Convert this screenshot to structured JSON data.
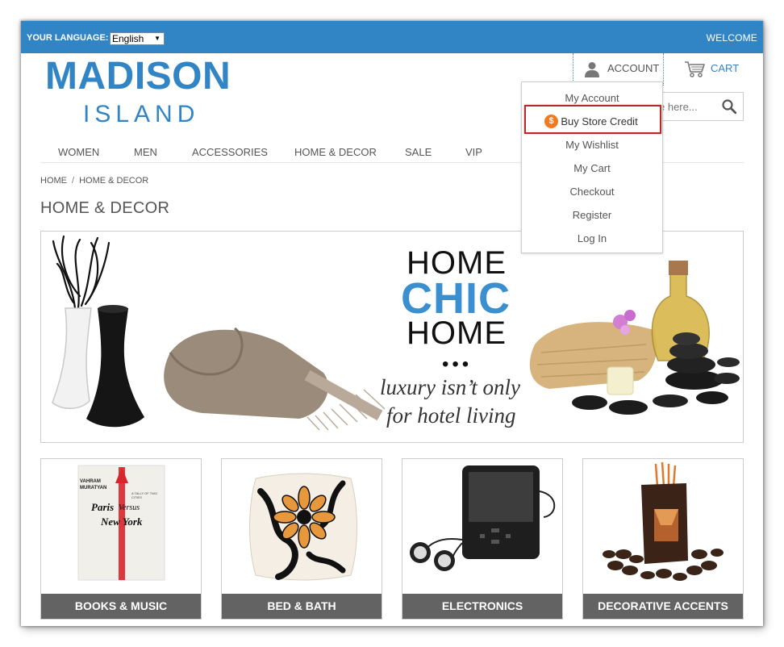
{
  "topbar": {
    "language_label": "YOUR LANGUAGE:",
    "language_value": "English",
    "welcome": "WELCOME"
  },
  "logo": {
    "main": "MADISON",
    "sub": "ISLAND"
  },
  "header": {
    "account_label": "ACCOUNT",
    "cart_label": "CART",
    "search_placeholder": "e here..."
  },
  "nav": {
    "items": [
      "WOMEN",
      "MEN",
      "ACCESSORIES",
      "HOME & DECOR",
      "SALE",
      "VIP"
    ]
  },
  "breadcrumb": {
    "home": "HOME",
    "current": "HOME & DECOR",
    "separator": "/"
  },
  "page_title": "HOME & DECOR",
  "banner": {
    "line1": "HOME",
    "line2": "CHIC",
    "line3": "HOME",
    "dots": "•••",
    "tagline1": "luxury isn’t only",
    "tagline2": "for hotel living",
    "accent_color": "#3a8fd0"
  },
  "categories": [
    {
      "label": "BOOKS & MUSIC"
    },
    {
      "label": "BED & BATH"
    },
    {
      "label": "ELECTRONICS"
    },
    {
      "label": "DECORATIVE ACCENTS"
    }
  ],
  "book_cover": {
    "author": "VAHRAM MURATYAN",
    "title_line1": "Paris",
    "title_line2": "Versus",
    "title_line3": "New York",
    "subtitle": "A TALLY OF TWO CITIES"
  },
  "account_menu": {
    "items": [
      "My Account",
      "Buy Store Credit",
      "My Wishlist",
      "My Cart",
      "Checkout",
      "Register",
      "Log In"
    ],
    "highlighted_item": "Buy Store Credit",
    "coin_symbol": "$"
  },
  "colors": {
    "brand_blue": "#3285c4",
    "highlight_red": "#b52a2a",
    "tile_label_bg": "#636363",
    "coin_orange": "#f07a1f"
  },
  "icons": {
    "account": "user-icon",
    "cart": "cart-icon",
    "search": "search-icon",
    "coin": "coin-icon",
    "dropdown": "chevron-down-icon"
  }
}
